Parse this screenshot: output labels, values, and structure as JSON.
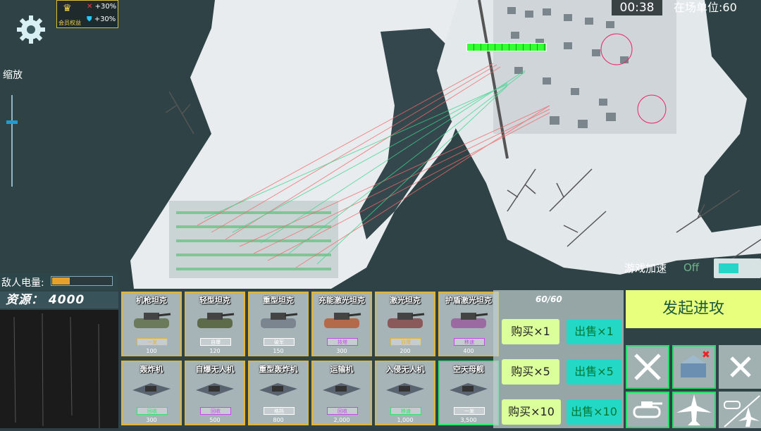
{
  "hud": {
    "vip_label": "会员权益",
    "bonus_attack": "+30%",
    "bonus_defense": "+30%",
    "zoom_label": "缩放",
    "timer": "00:38",
    "units_label": "在场单位:",
    "units_count": "60",
    "enemy_power_label": "敌人电量:",
    "enemy_power_level": 0.3,
    "resources_label": "资源：",
    "resources_value": "4000",
    "speed_label": "游戏加速",
    "speed_state": "Off",
    "capacity": "60/60",
    "attack_button": "发起进攻",
    "enemy_health_fraction": 1.0
  },
  "units_row1": [
    {
      "name": "机枪坦克",
      "tag": "一发",
      "tag_color": "#e0b63a",
      "price": "100"
    },
    {
      "name": "轻型坦克",
      "tag": "自爆",
      "tag_color": "#ffffff",
      "price": "120"
    },
    {
      "name": "重型坦克",
      "tag": "破军",
      "tag_color": "#ffffff",
      "price": "150"
    },
    {
      "name": "充能激光坦克",
      "tag": "技塔",
      "tag_color": "#c34ae6",
      "price": "300"
    },
    {
      "name": "激光坦克",
      "tag": "自爆",
      "tag_color": "#e0b63a",
      "price": "200"
    },
    {
      "name": "护盾激光坦克",
      "tag": "移速",
      "tag_color": "#c34ae6",
      "price": "400"
    }
  ],
  "units_row2": [
    {
      "name": "轰炸机",
      "tag": "回收",
      "tag_color": "#2ee66c",
      "price": "300"
    },
    {
      "name": "自爆无人机",
      "tag": "回收",
      "tag_color": "#c34ae6",
      "price": "500"
    },
    {
      "name": "重型轰炸机",
      "tag": "格挡",
      "tag_color": "#ffffff",
      "price": "800"
    },
    {
      "name": "运输机",
      "tag": "回收",
      "tag_color": "#c34ae6",
      "price": "2,000"
    },
    {
      "name": "入侵无人机",
      "tag": "移速",
      "tag_color": "#2ee66c",
      "price": "1,000"
    },
    {
      "name": "空天母舰",
      "tag": "一发",
      "tag_color": "#ffffff",
      "price": "3,500"
    }
  ],
  "trade": {
    "buy1": "购买×1",
    "sell1": "出售×1",
    "buy5": "购买×5",
    "sell5": "出售×5",
    "buy10": "购买×10",
    "sell10": "出售×10"
  },
  "icons": [
    "gear-icon",
    "crown-icon",
    "sword-icon",
    "shield-icon",
    "crossed-swords-icon",
    "base-icon",
    "close-icon",
    "tank-icon",
    "plane-icon",
    "no-air-icon"
  ]
}
